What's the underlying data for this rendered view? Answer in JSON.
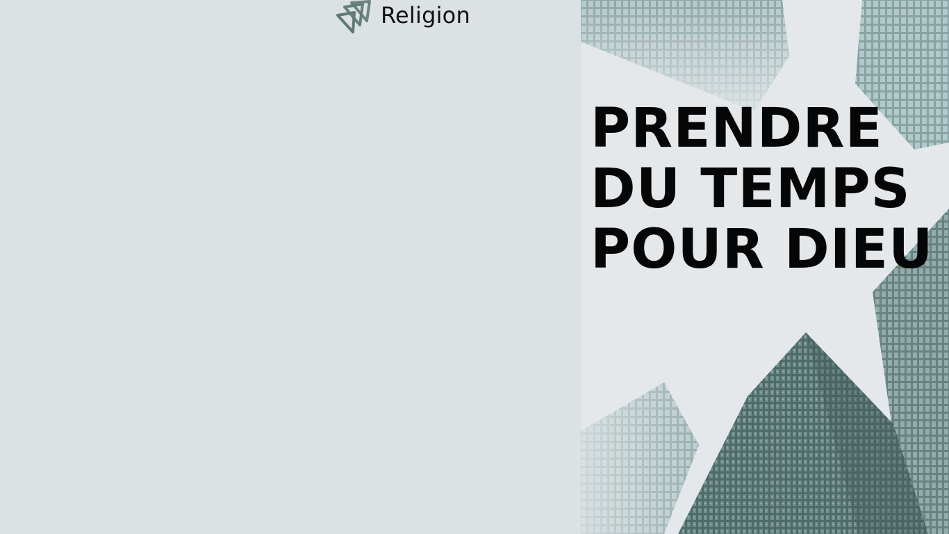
{
  "brand": {
    "name": "Religion",
    "logo_icon": "layered-chevron-logo-icon",
    "logo_color": "#5e7a74"
  },
  "hero": {
    "headline_lines": [
      "PRENDRE",
      "DU TEMPS",
      "POUR DIEU"
    ],
    "image": "skyscrapers-looking-up-photo",
    "tint_color": "#6d8e8c"
  },
  "colors": {
    "background": "#dce1e3",
    "text": "#060606"
  }
}
